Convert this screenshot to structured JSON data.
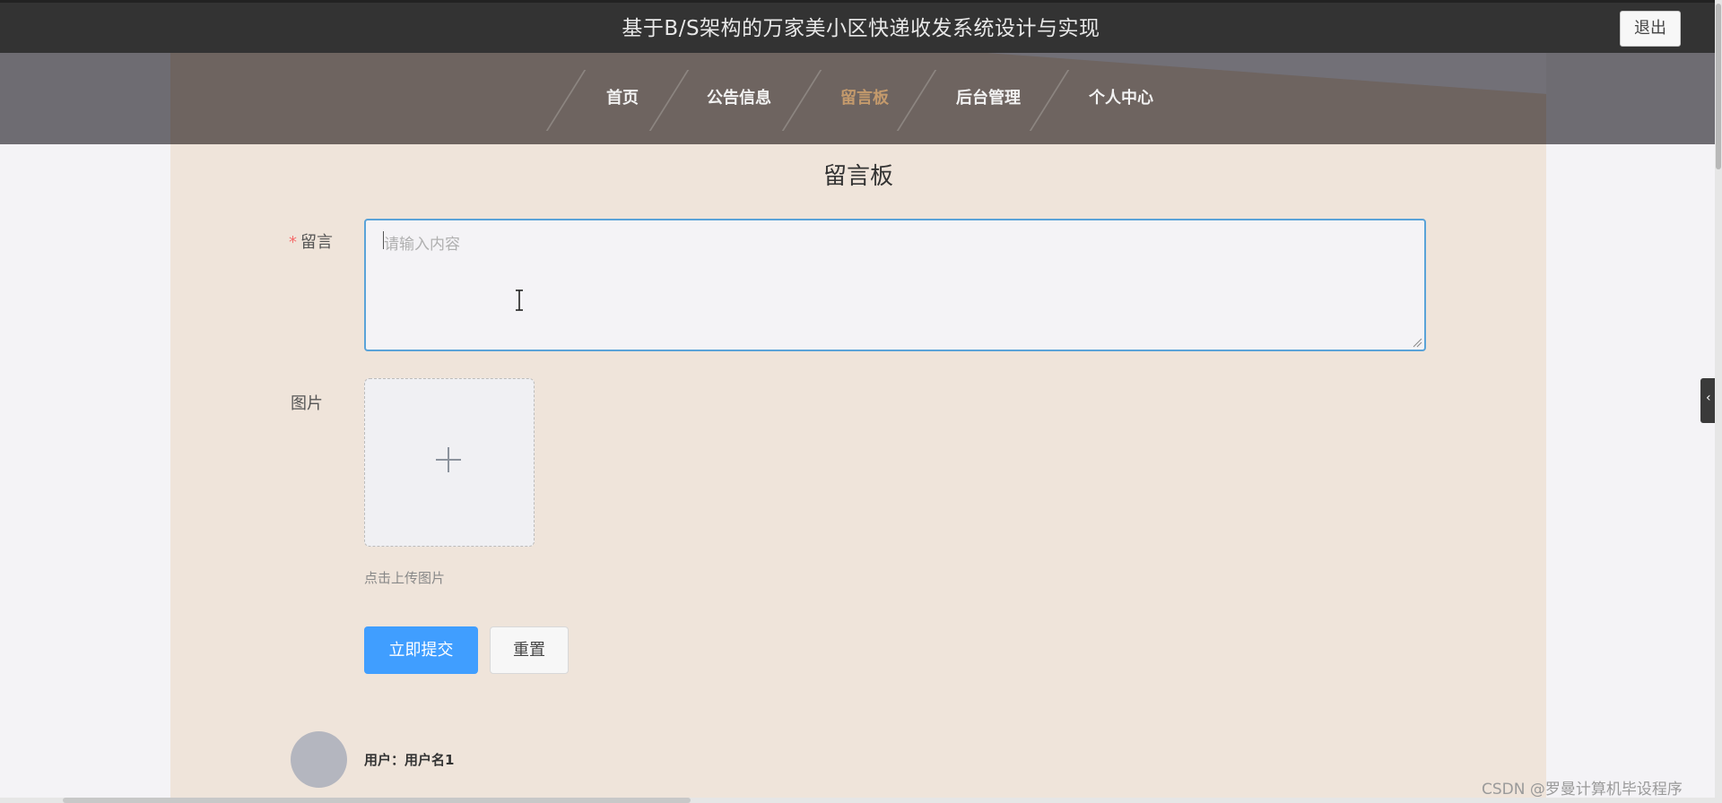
{
  "header": {
    "title": "基于B/S架构的万家美小区快递收发系统设计与实现",
    "logout_label": "退出"
  },
  "nav": {
    "items": [
      {
        "label": "首页",
        "active": false
      },
      {
        "label": "公告信息",
        "active": false
      },
      {
        "label": "留言板",
        "active": true
      },
      {
        "label": "后台管理",
        "active": false
      },
      {
        "label": "个人中心",
        "active": false
      }
    ]
  },
  "page": {
    "heading": "留言板"
  },
  "form": {
    "message_label": "留言",
    "required_mark": "*",
    "message_placeholder": "请输入内容",
    "message_value": "",
    "image_label": "图片",
    "upload_hint": "点击上传图片",
    "submit_label": "立即提交",
    "reset_label": "重置"
  },
  "comments": [
    {
      "user_line": "用户：用户名1"
    }
  ],
  "watermark": "CSDN @罗曼计算机毕设程序",
  "colors": {
    "accent": "#409eff",
    "nav_active": "#c49a6c",
    "required": "#f56c6c",
    "content_bg": "#efe4da",
    "topbar_bg": "#333333"
  },
  "icons": {
    "upload": "plus-icon",
    "side_tab": "chevron-left-icon",
    "cursor": "text-cursor-icon"
  }
}
